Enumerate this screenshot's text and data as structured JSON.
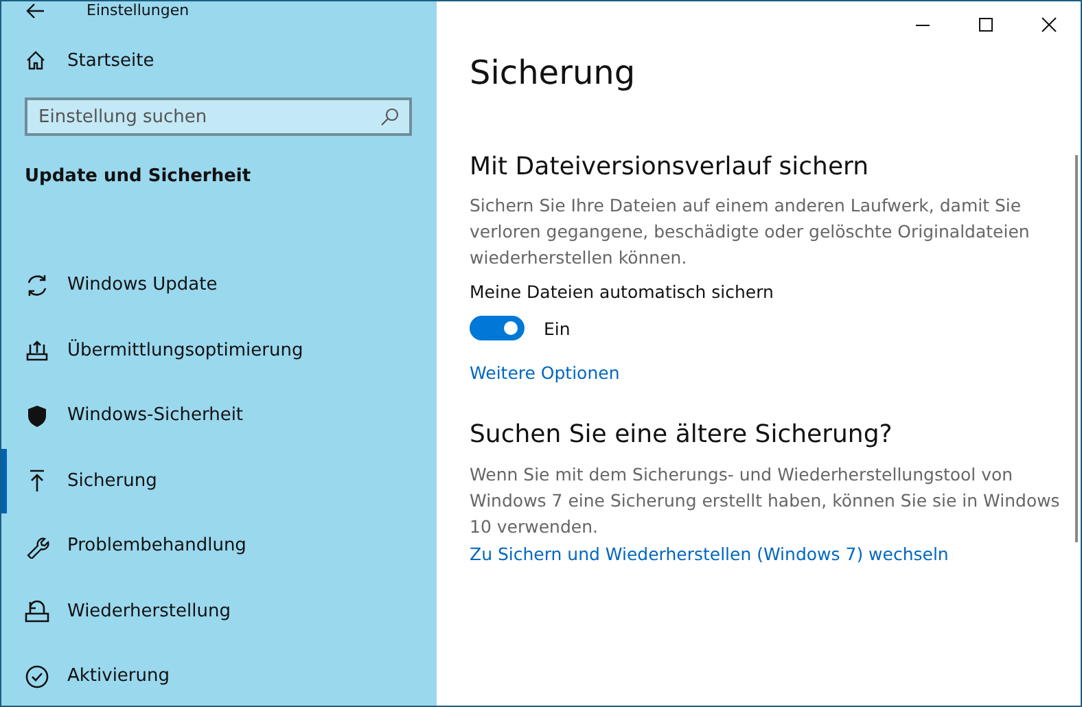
{
  "window": {
    "title": "Einstellungen"
  },
  "sidebar": {
    "home": "Startseite",
    "search": {
      "placeholder": "Einstellung suchen"
    },
    "section": "Update und Sicherheit",
    "items": [
      {
        "label": "Windows Update",
        "selected": false
      },
      {
        "label": "Übermittlungsoptimierung",
        "selected": false
      },
      {
        "label": "Windows-Sicherheit",
        "selected": false
      },
      {
        "label": "Sicherung",
        "selected": true
      },
      {
        "label": "Problembehandlung",
        "selected": false
      },
      {
        "label": "Wiederherstellung",
        "selected": false
      },
      {
        "label": "Aktivierung",
        "selected": false
      }
    ]
  },
  "page": {
    "title": "Sicherung",
    "file_history": {
      "heading": "Mit Dateiversionsverlauf sichern",
      "description": "Sichern Sie Ihre Dateien auf einem anderen Laufwerk, damit Sie verloren gegangene, beschädigte oder gelöschte Originaldateien wiederherstellen können.",
      "toggle_label": "Meine Dateien automatisch sichern",
      "toggle": {
        "on": true,
        "state_text": "Ein"
      },
      "link": "Weitere Optionen"
    },
    "older_backup": {
      "heading": "Suchen Sie eine ältere Sicherung?",
      "description": "Wenn Sie mit dem Sicherungs- und Wiederherstellungstool von Windows 7 eine Sicherung erstellt haben, können Sie sie in Windows 10 verwenden.",
      "link": "Zu Sichern und Wiederherstellen (Windows 7) wechseln"
    }
  }
}
